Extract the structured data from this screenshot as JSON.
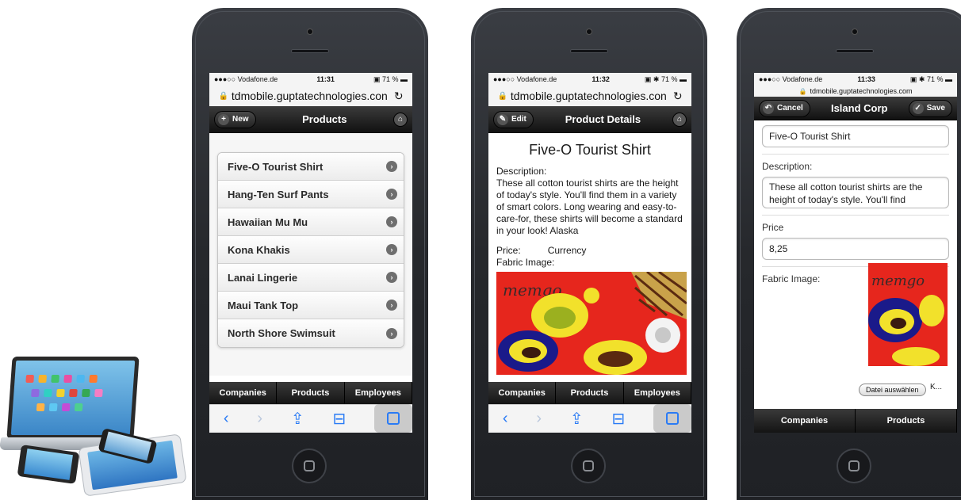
{
  "status": {
    "carrier": "●●●○○ Vodafone.de",
    "wifi": "wifi-icon",
    "battery_pct": "71 %",
    "time1": "11:31",
    "time2": "11:32",
    "time3": "11:33"
  },
  "url": {
    "full": "tdmobile.guptatechnologies.con",
    "short": "tdmobile.guptatechnologies.com"
  },
  "list_screen": {
    "new_label": "New",
    "title": "Products",
    "items": [
      "Five-O Tourist Shirt",
      "Hang-Ten Surf Pants",
      "Hawaiian Mu Mu",
      "Kona Khakis",
      "Lanai Lingerie",
      "Maui Tank Top",
      "North Shore Swimsuit"
    ]
  },
  "details_screen": {
    "edit_label": "Edit",
    "title": "Product Details",
    "product_name": "Five-O Tourist Shirt",
    "description_label": "Description:",
    "description_text": "These all cotton tourist shirts are the height of today's style. You'll find them in a variety of smart colors. Long wearing and easy-to-care-for, these shirts will become a standard in your look! Alaska",
    "price_label": "Price:",
    "price_value": "Currency",
    "fabric_label": "Fabric Image:"
  },
  "edit_screen": {
    "cancel_label": "Cancel",
    "title": "Island Corp",
    "save_label": "Save",
    "name_value": "Five-O Tourist Shirt",
    "description_label": "Description:",
    "description_value": "These all cotton tourist shirts are the height of today's style.  You'll find",
    "price_label": "Price",
    "price_value": "8,25",
    "fabric_label": "Fabric Image:",
    "file_button": "Datei auswählen",
    "file_status": "K..."
  },
  "navbar": {
    "companies": "Companies",
    "products": "Products",
    "employees": "Employees"
  },
  "colors": {
    "ios_blue": "#2a7bf5",
    "header_dark": "#111111",
    "fabric_red": "#e6261d"
  }
}
